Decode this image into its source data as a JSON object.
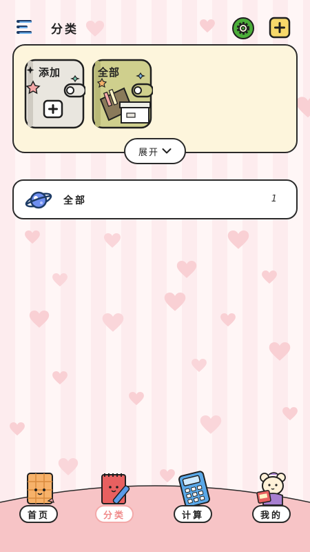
{
  "header": {
    "title": "分类"
  },
  "categories": {
    "add_label": "添加",
    "all_label": "全部",
    "expand_label": "展开"
  },
  "list": {
    "items": [
      {
        "label": "全部",
        "count": "1"
      }
    ]
  },
  "nav": {
    "items": [
      {
        "label": "首页"
      },
      {
        "label": "分类"
      },
      {
        "label": "计算"
      },
      {
        "label": "我的"
      }
    ]
  },
  "colors": {
    "panel_bg": "#fdf5dc",
    "accent_pink": "#f08a8a",
    "gear_green": "#4caf3a",
    "add_yellow": "#f7d86a"
  }
}
